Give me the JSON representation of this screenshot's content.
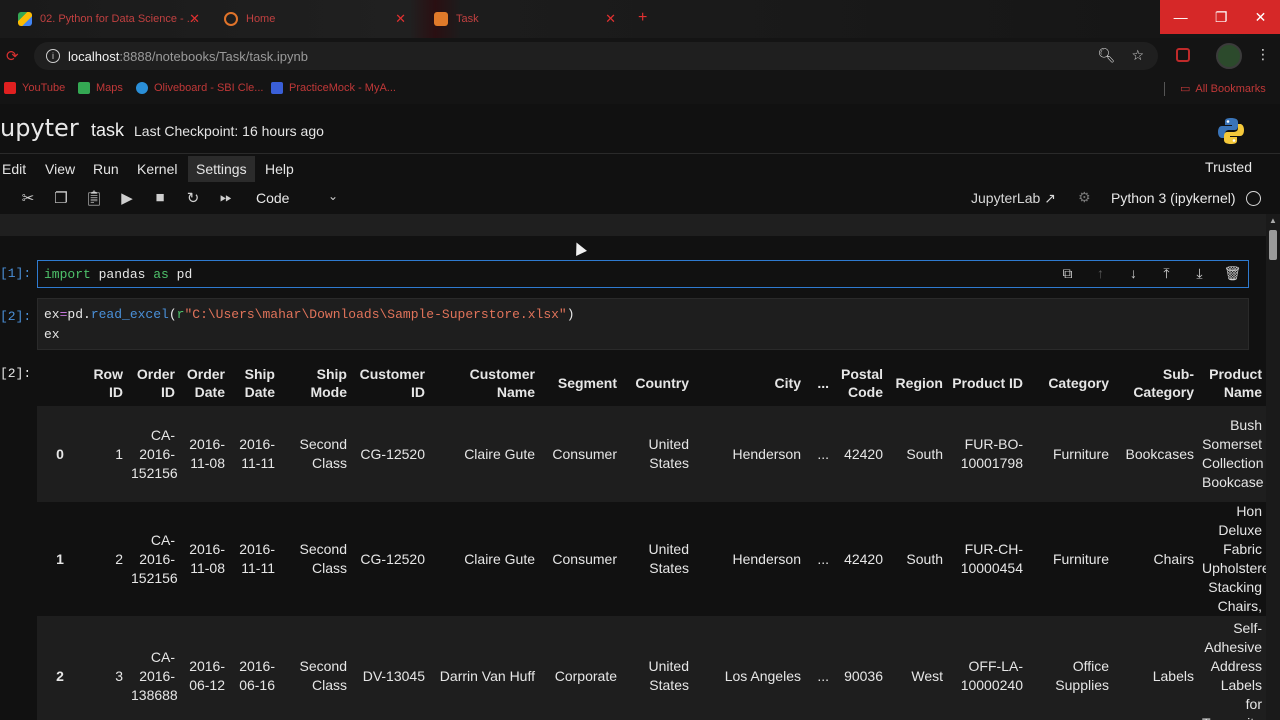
{
  "browser": {
    "tabs": [
      {
        "title": "02. Python for Data Science - ...",
        "color": "#e8b43a"
      },
      {
        "title": "Home",
        "color": "#e0732a"
      },
      {
        "title": "Task",
        "color": "#e07a2a"
      }
    ],
    "url_host": "localhost",
    "url_path": ":8888/notebooks/Task/task.ipynb",
    "bookmarks": [
      {
        "label": "YouTube",
        "color": "#e02020"
      },
      {
        "label": "Maps",
        "color": "#34a853"
      },
      {
        "label": "Oliveboard - SBI Cle...",
        "color": "#2a8fd8"
      },
      {
        "label": "PracticeMock - MyA...",
        "color": "#3a5fd8"
      }
    ],
    "all_bookmarks": "All Bookmarks"
  },
  "jupyter": {
    "logo": "upyter",
    "notebook_name": "task",
    "checkpoint": "Last Checkpoint: 16 hours ago",
    "menu": [
      "Edit",
      "View",
      "Run",
      "Kernel",
      "Settings",
      "Help"
    ],
    "trusted": "Trusted",
    "cell_type": "Code",
    "jupyterlab_link": "JupyterLab",
    "kernel": "Python 3 (ipykernel)"
  },
  "cells": {
    "in1_prompt": "[1]:",
    "in1_kw_import": "import",
    "in1_mod": " pandas ",
    "in1_kw_as": "as",
    "in1_alias": " pd",
    "in2_prompt": "[2]:",
    "in2_var": "ex",
    "in2_eq": "=",
    "in2_obj": "pd.",
    "in2_fn": "read_excel",
    "in2_open": "(",
    "in2_prefix": "r",
    "in2_str": "\"C:\\Users\\mahar\\Downloads\\Sample-Superstore.xlsx\"",
    "in2_close": ")",
    "in2_line2": "ex",
    "out2_prompt": "[2]:"
  },
  "dataframe": {
    "headers": [
      "",
      "Row ID",
      "Order ID",
      "Order Date",
      "Ship Date",
      "Ship Mode",
      "Customer ID",
      "Customer Name",
      "Segment",
      "Country",
      "City",
      "...",
      "Postal Code",
      "Region",
      "Product ID",
      "Category",
      "Sub-Category",
      "Product Name"
    ],
    "rows": [
      [
        "0",
        "1",
        "CA-2016-152156",
        "2016-11-08",
        "2016-11-11",
        "Second Class",
        "CG-12520",
        "Claire Gute",
        "Consumer",
        "United States",
        "Henderson",
        "...",
        "42420",
        "South",
        "FUR-BO-10001798",
        "Furniture",
        "Bookcases",
        "Bush Somerset Collection Bookcase"
      ],
      [
        "1",
        "2",
        "CA-2016-152156",
        "2016-11-08",
        "2016-11-11",
        "Second Class",
        "CG-12520",
        "Claire Gute",
        "Consumer",
        "United States",
        "Henderson",
        "...",
        "42420",
        "South",
        "FUR-CH-10000454",
        "Furniture",
        "Chairs",
        "Hon Deluxe Fabric Upholstered Stacking Chairs,"
      ],
      [
        "2",
        "3",
        "CA-2016-138688",
        "2016-06-12",
        "2016-06-16",
        "Second Class",
        "DV-13045",
        "Darrin Van Huff",
        "Corporate",
        "United States",
        "Los Angeles",
        "...",
        "90036",
        "West",
        "OFF-LA-10000240",
        "Office Supplies",
        "Labels",
        "Self-Adhesive Address Labels for Typewriters"
      ]
    ]
  }
}
